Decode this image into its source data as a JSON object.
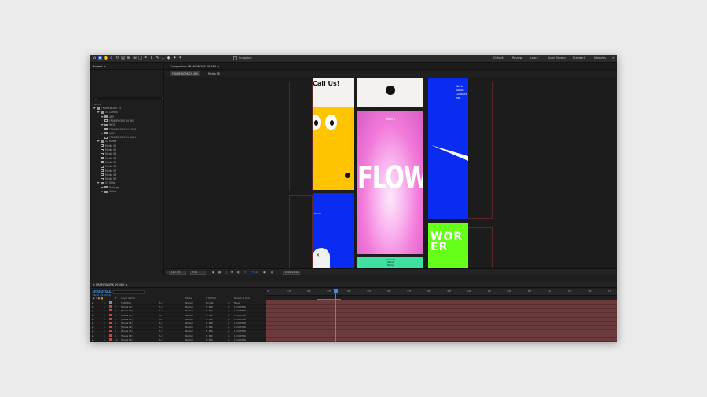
{
  "workspace": [
    "Default",
    "Review",
    "Learn",
    "Small Screen",
    "Standard",
    "Libraries"
  ],
  "workspace_more": "≫",
  "toolbar": {
    "snapping_label": "Snapping"
  },
  "project": {
    "title": "Project ≡",
    "search_placeholder": "ρ▾",
    "col_name": "Name",
    "tree": [
      {
        "label": "FRAMEWORK 19",
        "kind": "folder",
        "indent": 0
      },
      {
        "label": "01 Comps",
        "kind": "folder",
        "indent": 1
      },
      {
        "label": "4K5",
        "kind": "folder",
        "indent": 2
      },
      {
        "label": "FRAMEWORK 19 4K5",
        "kind": "comp",
        "indent": 3
      },
      {
        "label": "9K16",
        "kind": "folder",
        "indent": 2
      },
      {
        "label": "FRAMEWORK 19 9K16",
        "kind": "comp",
        "indent": 3
      },
      {
        "label": "16K9",
        "kind": "folder",
        "indent": 2
      },
      {
        "label": "FRAMEWORK 19 16K9",
        "kind": "comp",
        "indent": 3
      },
      {
        "label": "02 Media",
        "kind": "folder",
        "indent": 1
      },
      {
        "label": "Media 01",
        "kind": "comp",
        "indent": 2
      },
      {
        "label": "Media 02",
        "kind": "comp",
        "indent": 2
      },
      {
        "label": "Media 03",
        "kind": "comp",
        "indent": 2
      },
      {
        "label": "Media 04",
        "kind": "comp",
        "indent": 2
      },
      {
        "label": "Media 05",
        "kind": "comp",
        "indent": 2
      },
      {
        "label": "Media 06",
        "kind": "comp",
        "indent": 2
      },
      {
        "label": "Media 07",
        "kind": "comp",
        "indent": 2
      },
      {
        "label": "Media 08",
        "kind": "comp",
        "indent": 2
      },
      {
        "label": "Media 09",
        "kind": "comp",
        "indent": 2
      },
      {
        "label": "03 Other",
        "kind": "folder",
        "indent": 1
      },
      {
        "label": "Footage",
        "kind": "folder",
        "indent": 2
      },
      {
        "label": "Solids",
        "kind": "folder",
        "indent": 2
      }
    ],
    "bpc": "8 bpc"
  },
  "composition": {
    "title": "Composition FRAMEWORK 19 4K5 ≡",
    "tab_active": "FRAMEWORK 19 4K5",
    "tab_other": "Media 08",
    "call_us": "Call Us!",
    "flow": "FLOW",
    "menu_top": "MENU ≡",
    "nav_items": [
      "Work",
      "About",
      "Contact",
      "Ask"
    ],
    "home_label": "Home",
    "bottom_links": [
      "Contacts",
      "About",
      "Ramp"
    ],
    "worker_text": "WOR ER",
    "footer": {
      "zoom": "(30.7%)",
      "quality": "Full",
      "exposure": "+0.0",
      "timecode": "0:00:01:07"
    }
  },
  "timeline": {
    "tab_title": "FRAMEWORK 19 4K5 ≡",
    "timecode": "0:00:01:07",
    "timecode_sub": "00031 (25.00 fps)",
    "columns": {
      "num": "#",
      "layer_name": "Layer Name",
      "mode": "Mode",
      "trkmat": "T TrkMat",
      "parent": "Parent & Link"
    },
    "layers": [
      {
        "num": "1",
        "name": "CONTROL",
        "mode": "Normal",
        "trkmat": "No Mat",
        "parent": "None",
        "color": "#8c8c8c"
      },
      {
        "num": "2",
        "name": "[Media 01]",
        "mode": "Normal",
        "trkmat": "N. Mat",
        "parent": "1. CONTRO",
        "color": "#c04848"
      },
      {
        "num": "3",
        "name": "[Media 02]",
        "mode": "Normal",
        "trkmat": "N. Mat",
        "parent": "1. CONTRO",
        "color": "#c04848"
      },
      {
        "num": "4",
        "name": "[Media 03]",
        "mode": "Normal",
        "trkmat": "N. Mat",
        "parent": "1. CONTRO",
        "color": "#c04848"
      },
      {
        "num": "5",
        "name": "[Media 04]",
        "mode": "Normal",
        "trkmat": "N. Mat",
        "parent": "1. CONTRO",
        "color": "#c04848"
      },
      {
        "num": "6",
        "name": "[Media 05]",
        "mode": "Normal",
        "trkmat": "N. Mat",
        "parent": "1. CONTRO",
        "color": "#c04848"
      },
      {
        "num": "7",
        "name": "[Media 06]",
        "mode": "Normal",
        "trkmat": "N. Mat",
        "parent": "1. CONTRO",
        "color": "#c04848"
      },
      {
        "num": "8",
        "name": "[Media 07]",
        "mode": "Normal",
        "trkmat": "N. Mat",
        "parent": "1. CONTRO",
        "color": "#c04848"
      },
      {
        "num": "9",
        "name": "[Media 08]",
        "mode": "Normal",
        "trkmat": "N. Mat",
        "parent": "1. CONTRO",
        "color": "#c04848"
      },
      {
        "num": "10",
        "name": "[Media 09]",
        "mode": "Normal",
        "trkmat": "N. Mat",
        "parent": "1. CONTRO",
        "color": "#c04848"
      }
    ],
    "ruler_ticks": [
      "0s",
      "01f",
      "02f",
      "03f",
      "04f",
      "05f",
      "06f",
      "07f",
      "08f",
      "09f",
      "10f",
      "11f",
      "12f",
      "13f",
      "14f",
      "15f",
      "16f",
      "17f"
    ]
  },
  "colors": {
    "accent": "#3d8ae6",
    "blue_tile": "#0a2bf0",
    "yellow_tile": "#ffc400",
    "green_tile": "#66ff1a",
    "mint_tile": "#3fe0a0",
    "pink_gradient": "#f27ad9"
  }
}
